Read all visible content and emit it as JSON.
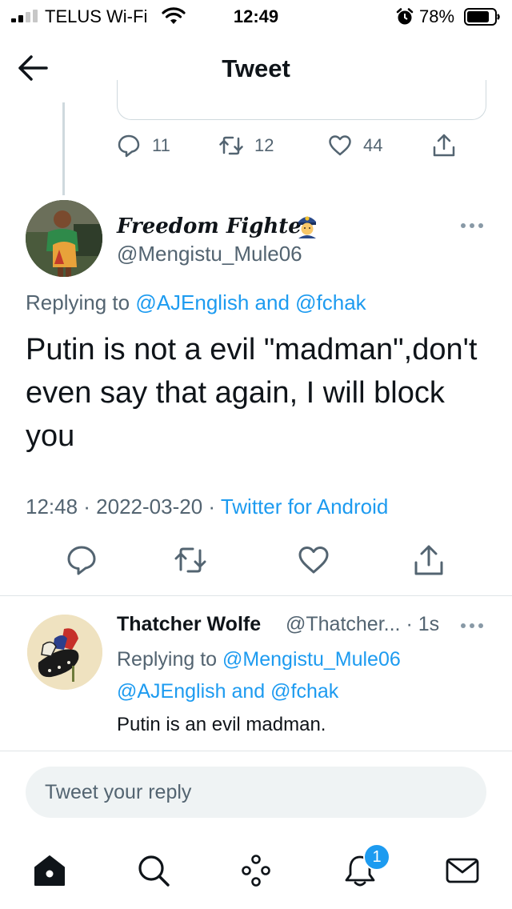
{
  "status_bar": {
    "carrier": "TELUS Wi-Fi",
    "time": "12:49",
    "battery": "78%"
  },
  "header": {
    "title": "Tweet"
  },
  "previous_tweet": {
    "reply_count": "11",
    "retweet_count": "12",
    "like_count": "44"
  },
  "main_tweet": {
    "display_name": "Freedom Fighter",
    "handle": "@Mengistu_Mule06",
    "replying_prefix": "Replying to ",
    "replying_users": "@AJEnglish and @fchak",
    "text": "Putin is not a evil \"madman\",don't even say that again, I will block you",
    "timestamp": "12:48 · 2022-03-20 · ",
    "source": "Twitter for Android"
  },
  "reply_tweet": {
    "display_name": "Thatcher Wolfe",
    "handle": "@Thatcher... · 1s",
    "replying_prefix": "Replying to ",
    "replying_users": "@Mengistu_Mule06 @AJEnglish and @fchak",
    "text": "Putin is an evil madman."
  },
  "composer": {
    "placeholder": "Tweet your reply"
  },
  "tab_bar": {
    "notification_badge": "1"
  },
  "colors": {
    "accent": "#1d9bf0",
    "secondary_text": "#536471",
    "primary_text": "#0f1419"
  },
  "icons": [
    "signal-icon",
    "wifi-icon",
    "alarm-icon",
    "battery-icon",
    "back-arrow-icon",
    "reply-icon",
    "retweet-icon",
    "like-icon",
    "share-icon",
    "more-icon",
    "police-officer-emoji-icon",
    "home-icon",
    "search-icon",
    "spaces-icon",
    "notifications-icon",
    "messages-icon"
  ]
}
